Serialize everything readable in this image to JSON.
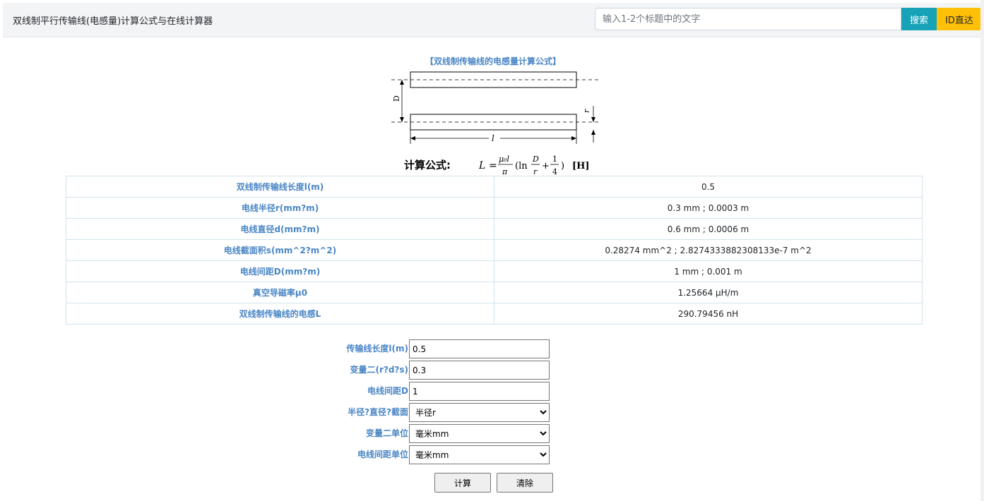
{
  "header": {
    "title": "双线制平行传输线(电感量)计算公式与在线计算器",
    "search_placeholder": "输入1-2个标题中的文字",
    "search_button": "搜索",
    "id_button": "ID直达"
  },
  "formula": {
    "heading": "【双线制传输线的电感量计算公式】",
    "label": "计算公式:",
    "diagram_label_D": "D",
    "diagram_label_r": "r",
    "diagram_label_l": "l",
    "expr_L": "L",
    "expr_eq": "=",
    "expr_num": "μ₀l",
    "expr_den": "π",
    "expr_ln": "(ln",
    "expr_D": "D",
    "expr_r": "r",
    "expr_plus": "+",
    "expr_one": "1",
    "expr_four": "4",
    "expr_close": ")",
    "unit": "[H]"
  },
  "results": [
    {
      "label": "双线制传输线长度l(m)",
      "value": "0.5"
    },
    {
      "label": "电线半径r(mm?m)",
      "value": "0.3 mm ; 0.0003 m"
    },
    {
      "label": "电线直径d(mm?m)",
      "value": "0.6 mm ; 0.0006 m"
    },
    {
      "label": "电线截面积s(mm^2?m^2)",
      "value": "0.28274 mm^2 ; 2.8274333882308133e-7 m^2"
    },
    {
      "label": "电线间距D(mm?m)",
      "value": "1 mm ; 0.001 m"
    },
    {
      "label": "真空导磁率μ0",
      "value": "1.25664 μH/m"
    },
    {
      "label": "双线制传输线的电感L",
      "value": "290.79456 nH"
    }
  ],
  "form": {
    "length_label": "传输线长度l(m)",
    "length_value": "0.5",
    "var2_label": "变量二(r?d?s)",
    "var2_value": "0.3",
    "spacing_label": "电线间距D",
    "spacing_value": "1",
    "type_label": "半径?直径?截面",
    "type_selected": "半径r",
    "var2_unit_label": "变量二单位",
    "var2_unit_selected": "毫米mm",
    "spacing_unit_label": "电线间距单位",
    "spacing_unit_selected": "毫米mm",
    "calc_button": "计算",
    "clear_button": "清除"
  }
}
